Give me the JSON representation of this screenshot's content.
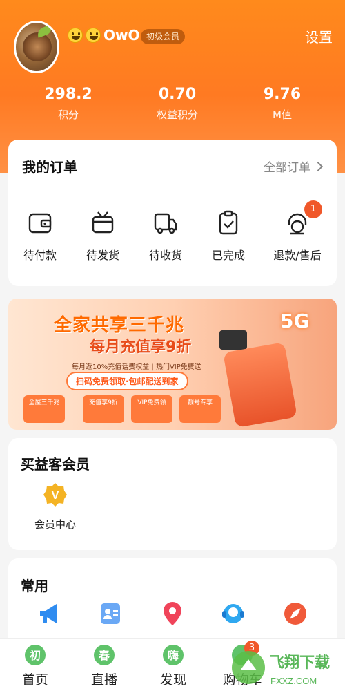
{
  "user": {
    "name_suffix": "OwO",
    "level": "初级会员",
    "settings_label": "设置"
  },
  "stats": [
    {
      "value": "298.2",
      "label": "积分"
    },
    {
      "value": "0.70",
      "label": "权益积分"
    },
    {
      "value": "9.76",
      "label": "M值"
    }
  ],
  "orders": {
    "title": "我的订单",
    "all_label": "全部订单",
    "items": [
      {
        "label": "待付款",
        "icon": "wallet-icon"
      },
      {
        "label": "待发货",
        "icon": "box-icon"
      },
      {
        "label": "待收货",
        "icon": "delivery-truck-icon"
      },
      {
        "label": "已完成",
        "icon": "clipboard-check-icon"
      },
      {
        "label": "退款/售后",
        "icon": "headset-icon",
        "badge": "1"
      }
    ]
  },
  "banner": {
    "line1": "全家共享三千兆",
    "line2": "每月充值享9折",
    "line3": "每月返10%充值话费权益 | 热门VIP免费送",
    "cta": "扫码免费领取·包邮配送到家",
    "tag": "5G",
    "mini": [
      "全屋三千兆",
      "充值享9折",
      "VIP免费领",
      "靓号专享"
    ]
  },
  "vip": {
    "title": "买益客会员",
    "item_label": "会员中心",
    "badge_letter": "V"
  },
  "common": {
    "title": "常用",
    "icons": [
      "megaphone-icon",
      "contact-card-icon",
      "location-pin-icon",
      "customer-service-icon",
      "compass-icon"
    ]
  },
  "tabbar": {
    "tabs": [
      {
        "label": "首页",
        "icon_text": "初",
        "icon": "home-icon"
      },
      {
        "label": "直播",
        "icon_text": "春",
        "icon": "live-icon"
      },
      {
        "label": "发现",
        "icon_text": "嗨",
        "icon": "discover-icon"
      },
      {
        "label": "购物车",
        "icon_text": "",
        "icon": "cart-icon",
        "badge": "3"
      }
    ]
  },
  "watermark": {
    "text": "飞翔下载",
    "url": "FXXZ.COM"
  },
  "colors": {
    "header": "#ff8a1c",
    "accent": "#f0582a",
    "vip_gold": "#f4b324"
  }
}
